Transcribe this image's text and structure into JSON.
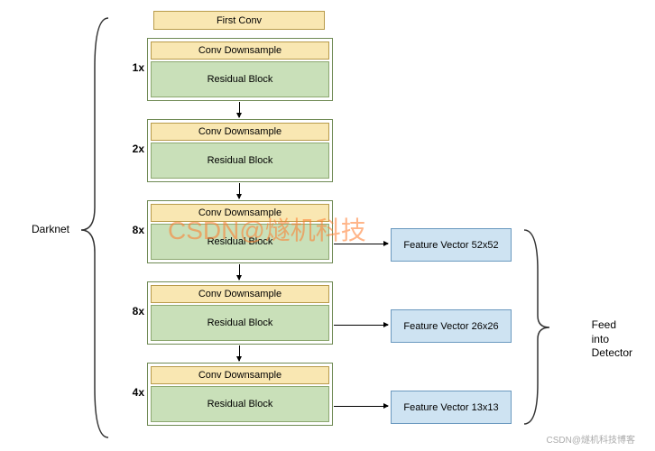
{
  "labels": {
    "darknet": "Darknet",
    "feed": "Feed\ninto\nDetector"
  },
  "first_conv": "First Conv",
  "stages": [
    {
      "mult": "1x",
      "conv": "Conv Downsample",
      "resid": "Residual Block"
    },
    {
      "mult": "2x",
      "conv": "Conv Downsample",
      "resid": "Residual Block"
    },
    {
      "mult": "8x",
      "conv": "Conv Downsample",
      "resid": "Residual Block",
      "fv": "Feature Vector 52x52"
    },
    {
      "mult": "8x",
      "conv": "Conv Downsample",
      "resid": "Residual Block",
      "fv": "Feature Vector 26x26"
    },
    {
      "mult": "4x",
      "conv": "Conv Downsample",
      "resid": "Residual Block",
      "fv": "Feature Vector 13x13"
    }
  ],
  "watermarks": {
    "w1": "CSDN@燧机科技",
    "w2": "CSDN@燧机科技博客"
  },
  "chart_data": {
    "type": "diagram",
    "network": "Darknet backbone",
    "layers": [
      {
        "name": "First Conv"
      },
      {
        "name": "Conv Downsample + Residual Block",
        "repeat": 1
      },
      {
        "name": "Conv Downsample + Residual Block",
        "repeat": 2
      },
      {
        "name": "Conv Downsample + Residual Block",
        "repeat": 8,
        "output": "Feature Vector 52x52"
      },
      {
        "name": "Conv Downsample + Residual Block",
        "repeat": 8,
        "output": "Feature Vector 26x26"
      },
      {
        "name": "Conv Downsample + Residual Block",
        "repeat": 4,
        "output": "Feature Vector 13x13"
      }
    ],
    "feature_outputs_feed_into": "Detector"
  }
}
